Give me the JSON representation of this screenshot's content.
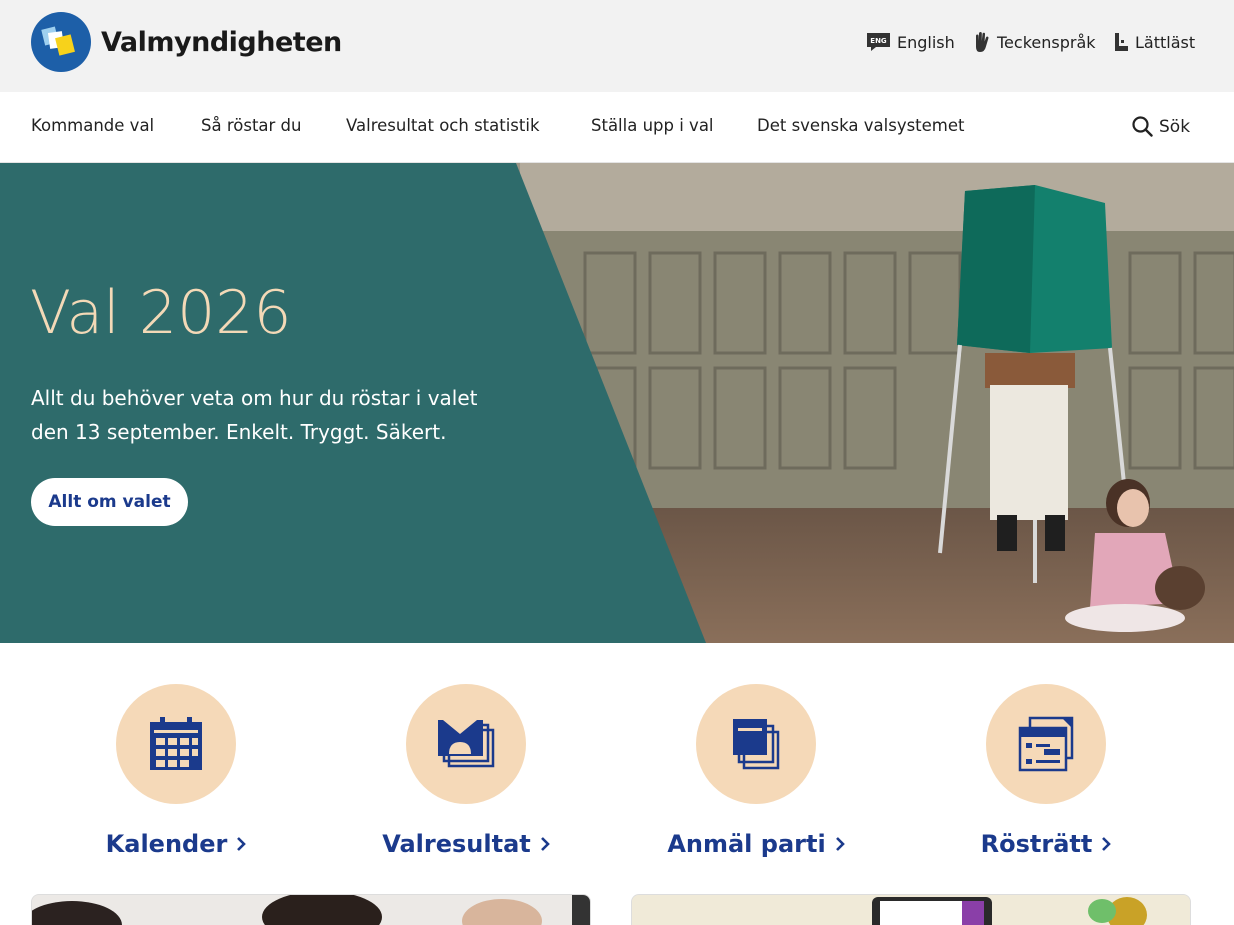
{
  "header": {
    "logo_text": "Valmyndigheten",
    "utility_links": [
      {
        "label": "English",
        "icon": "eng-language-icon",
        "icon_text": "ENG"
      },
      {
        "label": "Teckenspråk",
        "icon": "sign-language-hand-icon"
      },
      {
        "label": "Lättläst",
        "icon": "easy-read-icon"
      }
    ]
  },
  "nav": {
    "items": [
      {
        "label": "Kommande val"
      },
      {
        "label": "Så röstar du"
      },
      {
        "label": "Valresultat och statistik"
      },
      {
        "label": "Ställa upp i val"
      },
      {
        "label": "Det svenska valsystemet"
      }
    ],
    "search_label": "Sök"
  },
  "hero": {
    "title": "Val 2026",
    "text": "Allt du behöver veta om hur du röstar i valet den 13 september. Enkelt. Tryggt. Säkert.",
    "button_label": "Allt om valet"
  },
  "quick_links": [
    {
      "label": "Kalender",
      "icon": "calendar-icon"
    },
    {
      "label": "Valresultat",
      "icon": "ballot-box-icon"
    },
    {
      "label": "Anmäl parti",
      "icon": "documents-stack-icon"
    },
    {
      "label": "Rösträtt",
      "icon": "voting-card-icon"
    }
  ],
  "colors": {
    "hero_teal": "#2e6b6b",
    "hero_title": "#f3d9b7",
    "accent_blue": "#1b3a8c",
    "circle_peach": "#f5d9b8",
    "topbar_bg": "#f2f2f2"
  }
}
